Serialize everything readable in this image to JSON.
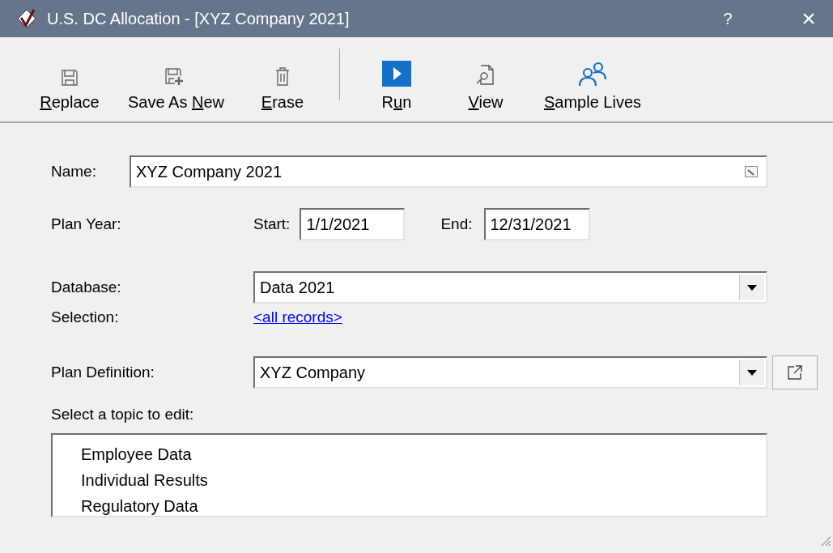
{
  "window": {
    "title": "U.S. DC Allocation - [XYZ Company 2021]",
    "help": "?",
    "close": "×"
  },
  "toolbar": [
    {
      "kind": "button",
      "label": "Replace"
    },
    {
      "kind": "button",
      "label": "Save As New"
    },
    {
      "kind": "button",
      "label": "Erase"
    },
    {
      "kind": "separator"
    },
    {
      "kind": "button",
      "label": "Run"
    },
    {
      "kind": "button",
      "label": "View"
    },
    {
      "kind": "button",
      "label": "Sample Lives"
    }
  ],
  "form": {
    "name": {
      "label": "Name:",
      "value": "XYZ Company 2021"
    },
    "plan_year": {
      "label": "Plan Year:",
      "start_label": "Start:",
      "start": "1/1/2021",
      "end_label": "End:",
      "end": "12/31/2021"
    },
    "database": {
      "label": "Database:",
      "value": "Data 2021"
    },
    "selection": {
      "label": "Selection:",
      "link": "<all records>"
    },
    "plan_definition": {
      "label": "Plan Definition:",
      "value": "XYZ Company"
    },
    "topics": {
      "label": "Select a topic to edit:",
      "items": [
        {
          "label": "Employee Data",
          "selected": false
        },
        {
          "label": "Individual Results",
          "selected": false
        },
        {
          "label": "Regulatory Data",
          "selected": false
        }
      ]
    }
  }
}
